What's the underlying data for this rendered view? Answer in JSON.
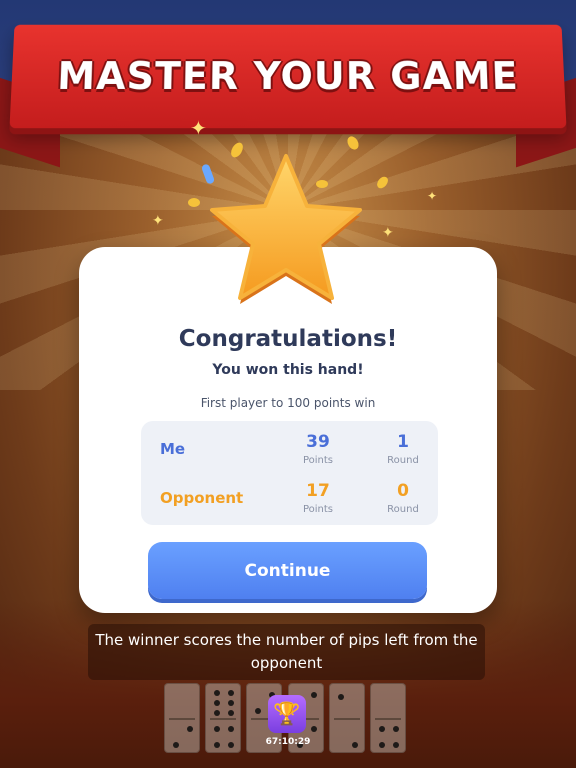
{
  "banner": {
    "title": "MASTER YOUR GAME"
  },
  "dialog": {
    "title": "Congratulations!",
    "subtitle": "You won this hand!",
    "rule": "First player to 100 points win",
    "scores": [
      {
        "name": "Me",
        "points": "39",
        "points_label": "Points",
        "round": "1",
        "round_label": "Round",
        "color": "#4a6fd8"
      },
      {
        "name": "Opponent",
        "points": "17",
        "points_label": "Points",
        "round": "0",
        "round_label": "Round",
        "color": "#f2a023"
      }
    ],
    "continue_label": "Continue"
  },
  "tip": {
    "text": "The winner scores the number of pips left from the opponent"
  },
  "hud": {
    "timer": "67:10:29",
    "trophy_icon": "trophy-icon"
  },
  "colors": {
    "banner_red": "#d42626",
    "button_blue": "#5b8df5",
    "me_blue": "#4a6fd8",
    "opponent_orange": "#f2a023"
  }
}
